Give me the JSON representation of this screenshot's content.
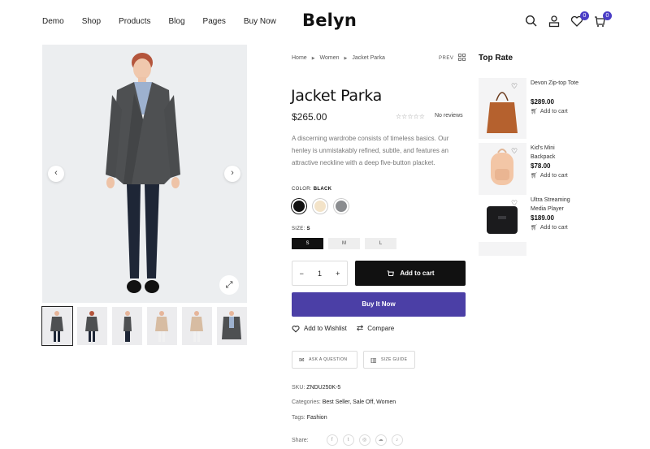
{
  "header": {
    "nav": [
      "Demo",
      "Shop",
      "Products",
      "Blog",
      "Pages",
      "Buy Now"
    ],
    "logo": "Belyn",
    "wishlist_count": "0",
    "cart_count": "0"
  },
  "breadcrumb": {
    "items": [
      "Home",
      "Women",
      "Jacket Parka"
    ],
    "prev": "PREV"
  },
  "product": {
    "title": "Jacket Parka",
    "price": "$265.00",
    "stars": "☆☆☆☆☆",
    "reviews": "No reviews",
    "description": "A discerning wardrobe consists of timeless basics. Our henley is unmistakably refined, subtle, and features an attractive neckline with a deep five-button placket.",
    "color_label": "COLOR:",
    "color_value": "BLACK",
    "colors": [
      "#111111",
      "#f3e3c8",
      "#8a8c8f"
    ],
    "size_label": "SIZE:",
    "size_value": "S",
    "sizes": [
      "S",
      "M",
      "L"
    ],
    "quantity": "1",
    "qty_minus": "−",
    "qty_plus": "+",
    "add_to_cart": "Add to cart",
    "buy_now": "Buy It Now",
    "wishlist": "Add to Wishlist",
    "compare": "Compare",
    "ask_question": "ASK A QUESTION",
    "size_guide": "SIZE GUIDE",
    "sku_label": "SKU:",
    "sku": "ZNDU250K-5",
    "categories_label": "Categories:",
    "categories": "Best Seller, Sale Off, Women",
    "tags_label": "Tags:",
    "tags": "Fashion",
    "share_label": "Share:",
    "share_icons": [
      "f",
      "t",
      "◎",
      "☁",
      "♪"
    ]
  },
  "gallery": {
    "prev_arrow": "‹",
    "next_arrow": "›",
    "zoom": "⤢",
    "thumbs": 6
  },
  "sidebar": {
    "title": "Top Rate",
    "items": [
      {
        "name": "Devon Zip-top Tote",
        "price": "$289.00",
        "add": "Add to cart"
      },
      {
        "name": "Kid's Mini Backpack",
        "price": "$78.00",
        "add": "Add to cart"
      },
      {
        "name": "Ultra Streaming Media Player",
        "price": "$189.00",
        "add": "Add to cart"
      }
    ]
  },
  "colors": {
    "accent": "#4b3fa6",
    "dark": "#111111"
  }
}
